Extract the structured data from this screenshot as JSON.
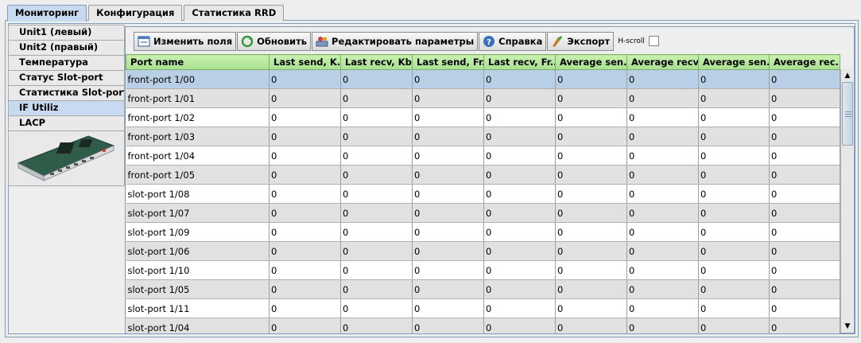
{
  "top_tabs": [
    {
      "label": "Мониторинг",
      "active": true
    },
    {
      "label": "Конфигурация",
      "active": false
    },
    {
      "label": "Статистика RRD",
      "active": false
    }
  ],
  "side_tabs": [
    {
      "label": "Unit1 (левый)",
      "active": false
    },
    {
      "label": "Unit2 (правый)",
      "active": false
    },
    {
      "label": "Температура",
      "active": false
    },
    {
      "label": "Статус Slot-port",
      "active": false
    },
    {
      "label": "Статистика Slot-port",
      "active": false
    },
    {
      "label": "IF Utiliz",
      "active": true
    },
    {
      "label": "LACP",
      "active": false
    }
  ],
  "toolbar": {
    "edit_fields": "Изменить поля",
    "refresh": "Обновить",
    "edit_params": "Редактировать параметры",
    "help": "Справка",
    "export": "Экспорт",
    "hscroll_label": "H-scroll",
    "hscroll_checked": false
  },
  "table": {
    "columns": [
      "Port name",
      "Last send, K...",
      "Last recv, Kb...",
      "Last send, Fr...",
      "Last recv, Fr...",
      "Average sen...",
      "Average recv...",
      "Average sen...",
      "Average rec..."
    ],
    "selected_row": 0,
    "rows": [
      [
        "front-port 1/00",
        "0",
        "0",
        "0",
        "0",
        "0",
        "0",
        "0",
        "0"
      ],
      [
        "front-port 1/01",
        "0",
        "0",
        "0",
        "0",
        "0",
        "0",
        "0",
        "0"
      ],
      [
        "front-port 1/02",
        "0",
        "0",
        "0",
        "0",
        "0",
        "0",
        "0",
        "0"
      ],
      [
        "front-port 1/03",
        "0",
        "0",
        "0",
        "0",
        "0",
        "0",
        "0",
        "0"
      ],
      [
        "front-port 1/04",
        "0",
        "0",
        "0",
        "0",
        "0",
        "0",
        "0",
        "0"
      ],
      [
        "front-port 1/05",
        "0",
        "0",
        "0",
        "0",
        "0",
        "0",
        "0",
        "0"
      ],
      [
        "slot-port 1/08",
        "0",
        "0",
        "0",
        "0",
        "0",
        "0",
        "0",
        "0"
      ],
      [
        "slot-port 1/07",
        "0",
        "0",
        "0",
        "0",
        "0",
        "0",
        "0",
        "0"
      ],
      [
        "slot-port 1/09",
        "0",
        "0",
        "0",
        "0",
        "0",
        "0",
        "0",
        "0"
      ],
      [
        "slot-port 1/06",
        "0",
        "0",
        "0",
        "0",
        "0",
        "0",
        "0",
        "0"
      ],
      [
        "slot-port 1/10",
        "0",
        "0",
        "0",
        "0",
        "0",
        "0",
        "0",
        "0"
      ],
      [
        "slot-port 1/05",
        "0",
        "0",
        "0",
        "0",
        "0",
        "0",
        "0",
        "0"
      ],
      [
        "slot-port 1/11",
        "0",
        "0",
        "0",
        "0",
        "0",
        "0",
        "0",
        "0"
      ],
      [
        "slot-port 1/04",
        "0",
        "0",
        "0",
        "0",
        "0",
        "0",
        "0",
        "0"
      ]
    ]
  },
  "colors": {
    "accent_tab": "#c8daf0",
    "header_green": "#a8e090",
    "selected_row": "#b8cfe5",
    "row_alt": "#e1e1e1"
  }
}
